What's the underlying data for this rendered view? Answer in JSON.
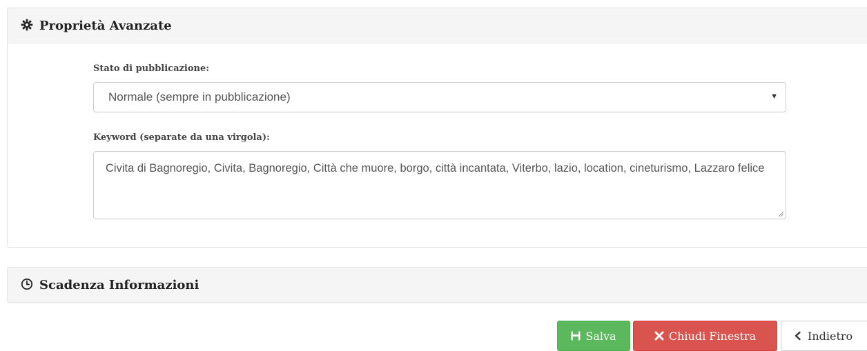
{
  "advanced_panel": {
    "title": "Proprietà Avanzate",
    "icon": "gear-icon",
    "publication_state": {
      "label": "Stato di pubblicazione:",
      "selected": "Normale (sempre in pubblicazione)"
    },
    "keywords": {
      "label": "Keyword (separate da una virgola):",
      "value": "Civita di Bagnoregio, Civita, Bagnoregio, Città che muore, borgo, città incantata, Viterbo, lazio, location, cineturismo, Lazzaro felice"
    }
  },
  "expiry_panel": {
    "title": "Scadenza Informazioni",
    "icon": "clock-icon"
  },
  "actions": {
    "save_label": "Salva",
    "close_label": "Chiudi Finestra",
    "back_label": "Indietro"
  },
  "colors": {
    "save": "#5cb85c",
    "close": "#d9534f",
    "back": "#ffffff",
    "panel_header": "#f5f5f5"
  }
}
